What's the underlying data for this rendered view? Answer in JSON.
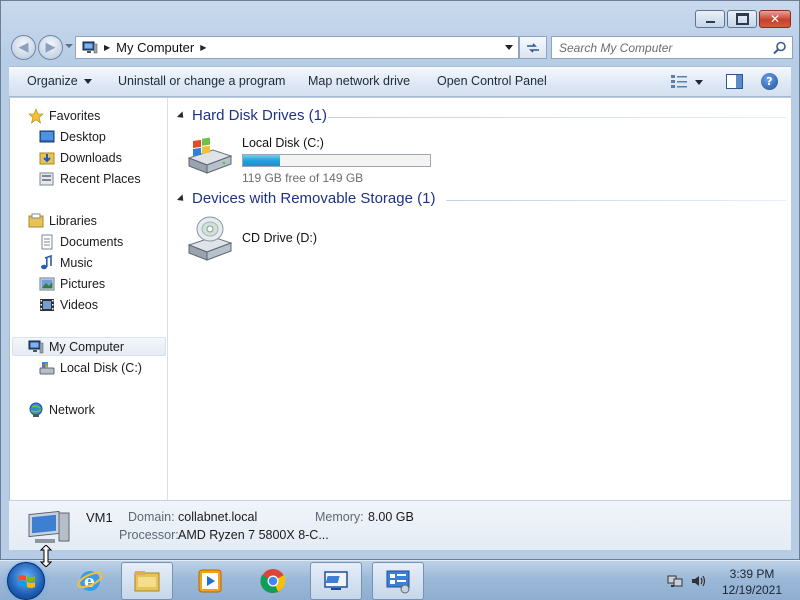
{
  "window": {
    "address": {
      "crumb": "My Computer"
    },
    "search": {
      "placeholder": "Search My Computer"
    }
  },
  "toolbar": {
    "organize": "Organize",
    "uninstall": "Uninstall or change a program",
    "map_drive": "Map network drive",
    "control_panel": "Open Control Panel"
  },
  "sidebar": {
    "favorites": "Favorites",
    "desktop": "Desktop",
    "downloads": "Downloads",
    "recent_places": "Recent Places",
    "libraries": "Libraries",
    "documents": "Documents",
    "music": "Music",
    "pictures": "Pictures",
    "videos": "Videos",
    "my_computer": "My Computer",
    "local_disk": "Local Disk (C:)",
    "network": "Network"
  },
  "main": {
    "hdd_group": "Hard Disk Drives (1)",
    "removable_group": "Devices with Removable Storage (1)",
    "drive_c": {
      "name": "Local Disk (C:)",
      "free_text": "119 GB free of 149 GB",
      "used_fraction": 0.2
    },
    "drive_d": {
      "name": "CD Drive (D:)"
    }
  },
  "details": {
    "name": "VM1",
    "domain_label": "Domain:",
    "domain_value": "collabnet.local",
    "memory_label": "Memory:",
    "memory_value": "8.00 GB",
    "processor_label": "Processor:",
    "processor_value": "AMD Ryzen 7 5800X 8-C..."
  },
  "taskbar": {
    "time": "3:39 PM",
    "date": "12/19/2021"
  },
  "colors": {
    "accent": "#1e3287",
    "capacity_bar": "#26a0da"
  }
}
